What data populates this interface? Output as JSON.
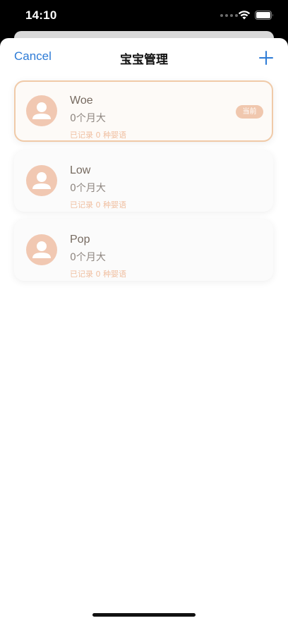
{
  "status_bar": {
    "time": "14:10"
  },
  "nav": {
    "cancel_label": "Cancel",
    "title": "宝宝管理",
    "add_icon": "plus-icon"
  },
  "babies": [
    {
      "name": "Woe",
      "age": "0个月大",
      "record": "已记录 0 种婴语",
      "badge": "当前",
      "selected": true
    },
    {
      "name": "Low",
      "age": "0个月大",
      "record": "已记录 0 种婴语",
      "selected": false
    },
    {
      "name": "Pop",
      "age": "0个月大",
      "record": "已记录 0 种婴语",
      "selected": false
    }
  ],
  "colors": {
    "accent_blue": "#2d7bd6",
    "avatar_bg": "#f1c8b2",
    "selected_border": "#f0caa8",
    "record_text": "#f0bfa0"
  }
}
